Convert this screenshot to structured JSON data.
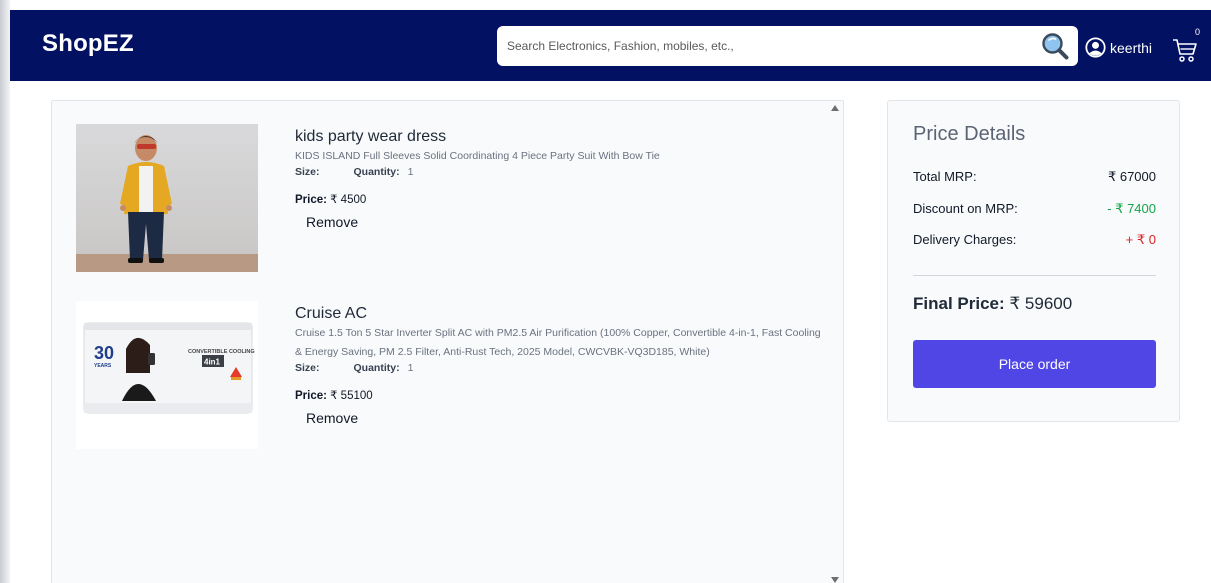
{
  "navbar": {
    "brand": "ShopEZ",
    "search_placeholder": "Search Electronics, Fashion, mobiles, etc.,",
    "username": "keerthi",
    "cart_count": "0",
    "search_icon": "search-icon",
    "user_icon": "user-circle-icon",
    "cart_icon": "cart-icon",
    "background": "#031162"
  },
  "cart": {
    "items": [
      {
        "title": "kids party wear dress",
        "description": "KIDS ISLAND Full Sleeves Solid Coordinating 4 Piece Party Suit With Bow Tie",
        "size_label": "Size:",
        "size_value": "",
        "quantity_label": "Quantity:",
        "quantity_value": "1",
        "price_label": "Price:",
        "price_value": "₹ 4500",
        "remove_label": "Remove"
      },
      {
        "title": "Cruise AC",
        "description": "Cruise 1.5 Ton 5 Star Inverter Split AC with PM2.5 Air Purification (100% Copper, Convertible 4-in-1, Fast Cooling & Energy Saving, PM 2.5 Filter, Anti-Rust Tech, 2025 Model, CWCVBK-VQ3D185, White)",
        "size_label": "Size:",
        "size_value": "",
        "quantity_label": "Quantity:",
        "quantity_value": "1",
        "price_label": "Price:",
        "price_value": "₹ 55100",
        "remove_label": "Remove",
        "image_text": {
          "years": "30",
          "years_label": "YEARS",
          "badge": "CONVERTIBLE COOLING",
          "badge_number": "4in1"
        }
      }
    ]
  },
  "price_details": {
    "title": "Price Details",
    "total_mrp_label": "Total MRP:",
    "total_mrp_value": "₹ 67000",
    "discount_label": "Discount on MRP:",
    "discount_value": "- ₹ 7400",
    "delivery_label": "Delivery Charges:",
    "delivery_value": "+ ₹ 0",
    "final_label": "Final Price:",
    "final_value": "₹ 59600",
    "order_button": "Place order",
    "colors": {
      "discount": "#16a34a",
      "delivery": "#dc2626",
      "button": "#4f46e5"
    }
  }
}
